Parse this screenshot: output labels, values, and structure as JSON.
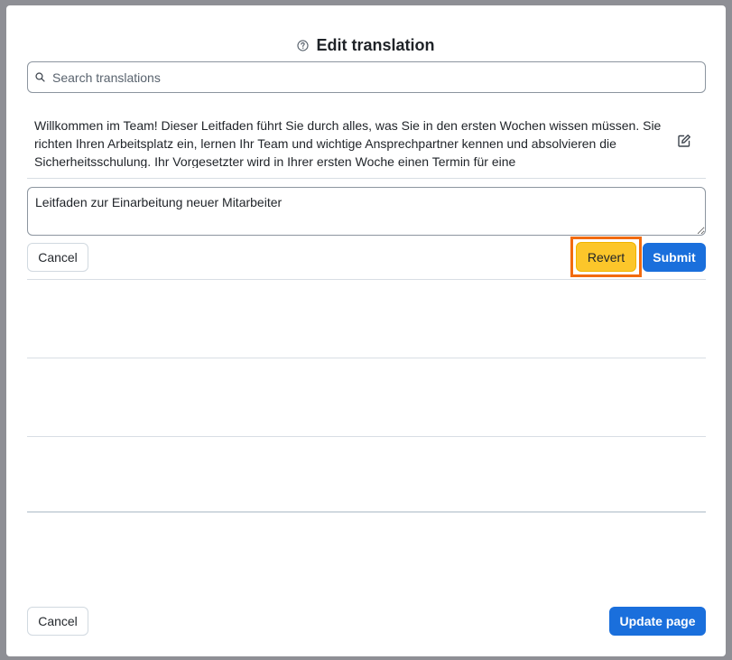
{
  "dialog": {
    "title": "Edit translation"
  },
  "search": {
    "placeholder": "Search translations",
    "value": ""
  },
  "source": {
    "text": "Willkommen im Team! Dieser Leitfaden führt Sie durch alles, was Sie in den ersten Wochen wissen müssen. Sie richten Ihren Arbeitsplatz ein, lernen Ihr Team und wichtige Ansprechpartner kennen und absolvieren die Sicherheitsschulung. Ihr Vorgesetzter wird in Ihrer ersten Woche einen Termin für eine"
  },
  "editor": {
    "value": "Leitfaden zur Einarbeitung neuer Mitarbeiter"
  },
  "editor_actions": {
    "cancel_label": "Cancel",
    "revert_label": "Revert",
    "submit_label": "Submit"
  },
  "footer": {
    "cancel_label": "Cancel",
    "update_label": "Update page"
  },
  "colors": {
    "primary": "#1a6fdc",
    "revert": "#fcc62a",
    "highlight": "#f26b0f"
  },
  "icons": {
    "title": "help-circle-icon",
    "search": "search-icon",
    "edit": "pencil-square-icon"
  }
}
